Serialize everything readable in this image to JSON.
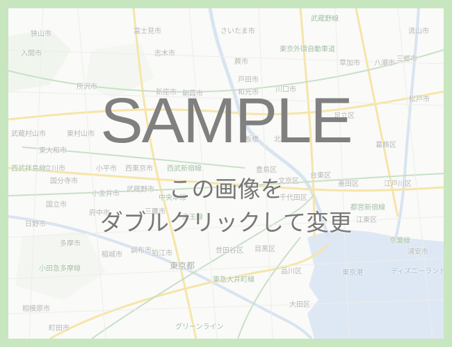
{
  "overlay": {
    "title": "SAMPLE",
    "line1": "この画像を",
    "line2": "ダブルクリックして変更"
  },
  "colors": {
    "frame": "#c8e6c0",
    "water": "#c9d9ef",
    "major_road": "#f5d56b",
    "rail": "#9fc79f",
    "overlay_text": "#808080"
  },
  "labels": [
    {
      "text": "武蔵野線",
      "kind": "road"
    },
    {
      "text": "さいたま市",
      "kind": "place"
    },
    {
      "text": "富士見市",
      "kind": "place"
    },
    {
      "text": "流山市",
      "kind": "place"
    },
    {
      "text": "狭山市",
      "kind": "place"
    },
    {
      "text": "入間市",
      "kind": "place"
    },
    {
      "text": "志木市",
      "kind": "place"
    },
    {
      "text": "東京外環自動車道",
      "kind": "road"
    },
    {
      "text": "蕨市",
      "kind": "place"
    },
    {
      "text": "草加市",
      "kind": "place"
    },
    {
      "text": "八潮市",
      "kind": "place"
    },
    {
      "text": "三郷市",
      "kind": "place"
    },
    {
      "text": "所沢市",
      "kind": "place"
    },
    {
      "text": "新座市",
      "kind": "place"
    },
    {
      "text": "朝霞市",
      "kind": "place"
    },
    {
      "text": "和光市",
      "kind": "place"
    },
    {
      "text": "戸田市",
      "kind": "place"
    },
    {
      "text": "川口市",
      "kind": "place"
    },
    {
      "text": "松戸市",
      "kind": "place"
    },
    {
      "text": "東村山市",
      "kind": "place"
    },
    {
      "text": "武蔵村山市",
      "kind": "place"
    },
    {
      "text": "足立区",
      "kind": "place"
    },
    {
      "text": "葛飾区",
      "kind": "place"
    },
    {
      "text": "東大和市",
      "kind": "place"
    },
    {
      "text": "北区",
      "kind": "place"
    },
    {
      "text": "板橋",
      "kind": "place"
    },
    {
      "text": "西武拝島線",
      "kind": "road"
    },
    {
      "text": "立川市",
      "kind": "place"
    },
    {
      "text": "小平市",
      "kind": "place"
    },
    {
      "text": "西東京市",
      "kind": "place"
    },
    {
      "text": "西武新宿線",
      "kind": "road"
    },
    {
      "text": "豊島区",
      "kind": "place"
    },
    {
      "text": "文京区",
      "kind": "place"
    },
    {
      "text": "台東区",
      "kind": "place"
    },
    {
      "text": "墨田区",
      "kind": "place"
    },
    {
      "text": "江戸川区",
      "kind": "place"
    },
    {
      "text": "国分寺市",
      "kind": "place"
    },
    {
      "text": "武蔵野市",
      "kind": "place"
    },
    {
      "text": "小金井市",
      "kind": "place"
    },
    {
      "text": "中央本線",
      "kind": "road"
    },
    {
      "text": "千代田区",
      "kind": "place"
    },
    {
      "text": "国立市",
      "kind": "place"
    },
    {
      "text": "三鷹市",
      "kind": "place"
    },
    {
      "text": "府中市",
      "kind": "place"
    },
    {
      "text": "日野市",
      "kind": "place"
    },
    {
      "text": "京王線",
      "kind": "road"
    },
    {
      "text": "都営新宿線",
      "kind": "road"
    },
    {
      "text": "江東区",
      "kind": "place"
    },
    {
      "text": "多摩市",
      "kind": "place"
    },
    {
      "text": "稲城市",
      "kind": "place"
    },
    {
      "text": "調布市",
      "kind": "place"
    },
    {
      "text": "狛江市",
      "kind": "place"
    },
    {
      "text": "世田谷区",
      "kind": "place"
    },
    {
      "text": "目黒区",
      "kind": "place"
    },
    {
      "text": "京葉線",
      "kind": "road"
    },
    {
      "text": "浦安市",
      "kind": "place"
    },
    {
      "text": "小田急多摩線",
      "kind": "road"
    },
    {
      "text": "東京都",
      "kind": "big"
    },
    {
      "text": "東京港",
      "kind": "blue"
    },
    {
      "text": "品川区",
      "kind": "place"
    },
    {
      "text": "東急大井町線",
      "kind": "road"
    },
    {
      "text": "ディズニーランド",
      "kind": "blue"
    },
    {
      "text": "大田区",
      "kind": "place"
    },
    {
      "text": "相模原市",
      "kind": "place"
    },
    {
      "text": "町田市",
      "kind": "place"
    },
    {
      "text": "グリーンライン",
      "kind": "road"
    }
  ]
}
